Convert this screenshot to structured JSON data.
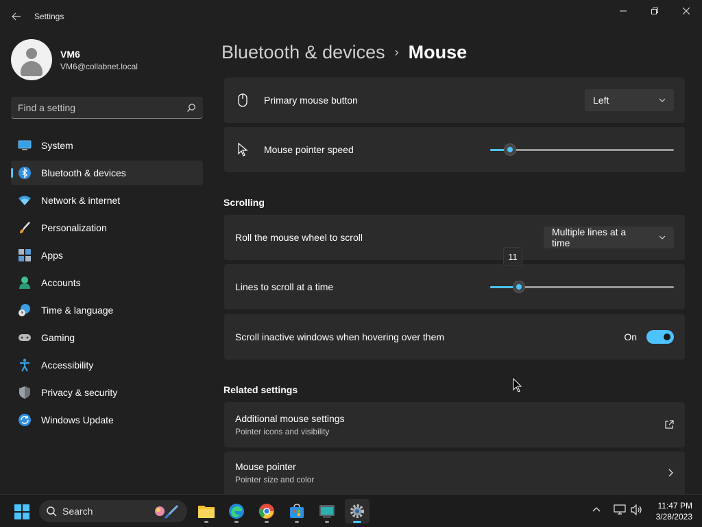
{
  "window": {
    "title": "Settings"
  },
  "user": {
    "name": "VM6",
    "email": "VM6@collabnet.local"
  },
  "search": {
    "placeholder": "Find a setting"
  },
  "sidebar": {
    "items": [
      {
        "label": "System",
        "icon": "system-icon"
      },
      {
        "label": "Bluetooth & devices",
        "icon": "bluetooth-icon",
        "active": true
      },
      {
        "label": "Network & internet",
        "icon": "wifi-icon"
      },
      {
        "label": "Personalization",
        "icon": "brush-icon"
      },
      {
        "label": "Apps",
        "icon": "apps-icon"
      },
      {
        "label": "Accounts",
        "icon": "accounts-icon"
      },
      {
        "label": "Time & language",
        "icon": "clock-globe-icon"
      },
      {
        "label": "Gaming",
        "icon": "gamepad-icon"
      },
      {
        "label": "Accessibility",
        "icon": "accessibility-icon"
      },
      {
        "label": "Privacy & security",
        "icon": "shield-icon"
      },
      {
        "label": "Windows Update",
        "icon": "update-icon"
      }
    ]
  },
  "breadcrumb": {
    "parent": "Bluetooth & devices",
    "separator": "›",
    "current": "Mouse"
  },
  "settings": {
    "primary_button": {
      "label": "Primary mouse button",
      "value": "Left"
    },
    "pointer_speed": {
      "label": "Mouse pointer speed",
      "level": 0.08
    },
    "scrolling_title": "Scrolling",
    "roll_wheel": {
      "label": "Roll the mouse wheel to scroll",
      "value": "Multiple lines at a time"
    },
    "lines_to_scroll": {
      "label": "Lines to scroll at a time",
      "value": "11",
      "level": 0.13
    },
    "scroll_inactive": {
      "label": "Scroll inactive windows when hovering over them",
      "state": "On",
      "on": true
    },
    "related_title": "Related settings",
    "additional": {
      "label": "Additional mouse settings",
      "sub": "Pointer icons and visibility"
    },
    "mouse_pointer": {
      "label": "Mouse pointer",
      "sub": "Pointer size and color"
    }
  },
  "colors": {
    "accent": "#4cc2ff",
    "background": "#202020",
    "card": "#2b2b2b"
  },
  "taskbar": {
    "search_label": "Search",
    "apps": [
      "file-explorer-icon",
      "edge-icon",
      "chrome-icon",
      "store-icon",
      "terminal-icon",
      "settings-icon"
    ],
    "time": "11:47 PM",
    "date": "3/28/2023"
  }
}
